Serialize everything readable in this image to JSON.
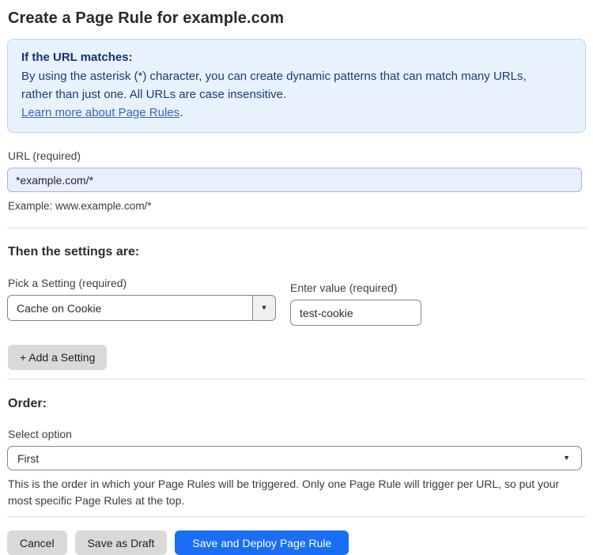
{
  "page": {
    "title": "Create a Page Rule for example.com"
  },
  "info_box": {
    "heading": "If the URL matches:",
    "body": "By using the asterisk (*) character, you can create dynamic patterns that can match many URLs, rather than just one. All URLs are case insensitive.",
    "link_label": "Learn more about Page Rules",
    "link_suffix": "."
  },
  "url_field": {
    "label": "URL (required)",
    "value": "*example.com/*",
    "helper": "Example: www.example.com/*"
  },
  "settings": {
    "heading": "Then the settings are:",
    "setting_label": "Pick a Setting (required)",
    "setting_value": "Cache on Cookie",
    "value_label": "Enter value (required)",
    "value_value": "test-cookie",
    "add_button_label": "+ Add a Setting"
  },
  "order": {
    "heading": "Order:",
    "select_label": "Select option",
    "selected_option": "First",
    "helper": "This is the order in which your Page Rules will be triggered. Only one Page Rule will trigger per URL, so put your most specific Page Rules at the top."
  },
  "footer": {
    "cancel_label": "Cancel",
    "save_draft_label": "Save as Draft",
    "save_deploy_label": "Save and Deploy Page Rule"
  },
  "icons": {
    "dropdown_caret": "▼"
  },
  "colors": {
    "accent_blue": "#1a6ef5",
    "info_bg": "#e8f2fc",
    "info_border": "#b9d6ef",
    "info_text": "#1d3b72",
    "link_blue": "#3565c0",
    "url_input_bg": "#e9effb",
    "button_gray": "#d9d9d9"
  }
}
